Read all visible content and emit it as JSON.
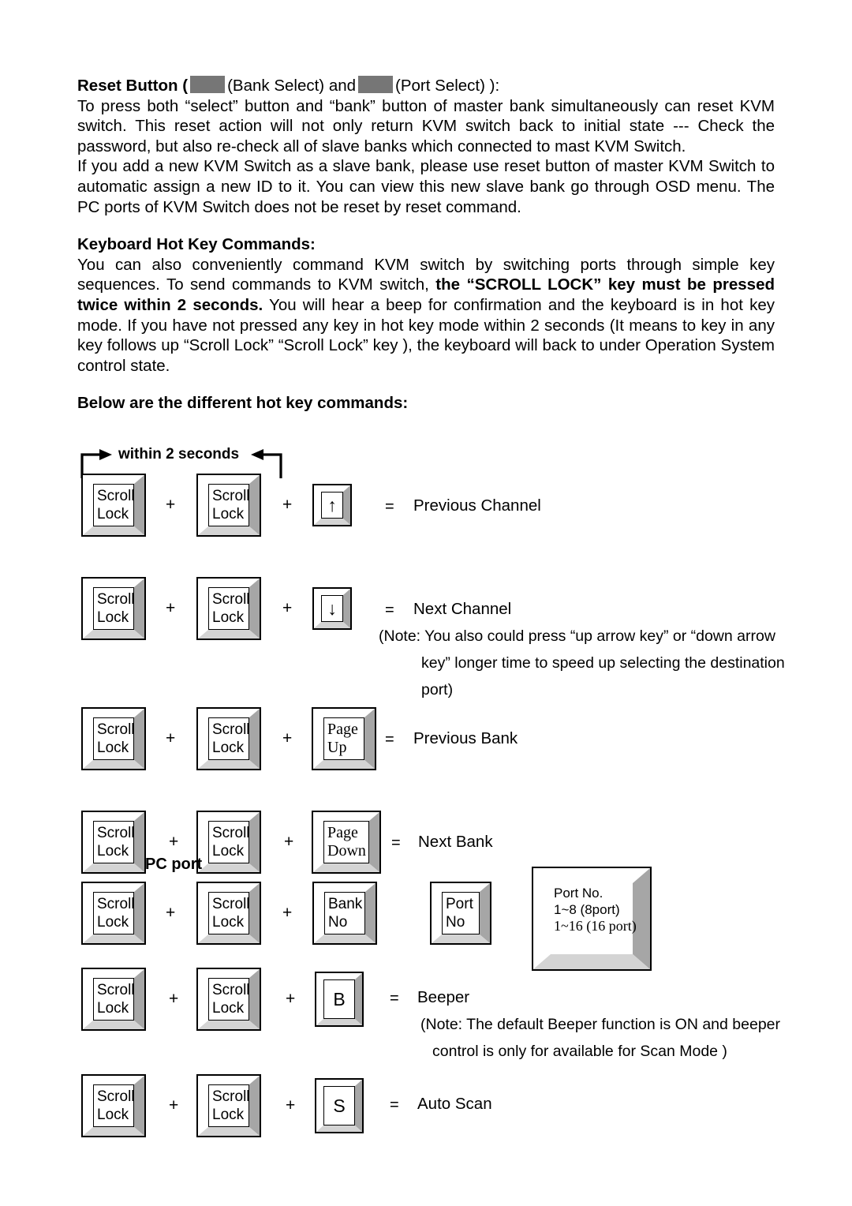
{
  "document": {
    "reset_section": {
      "heading_prefix": "Reset Button (",
      "bank_select_label": "(Bank Select) and",
      "port_select_label": "(Port Select) ):",
      "swatch_color": "#767676",
      "body": "To press both “select” button and “bank” button of master bank simultaneously can reset KVM switch. This reset action will not only return KVM switch back to initial state --- Check the password, but also re-check all of slave banks which connected to mast KVM Switch.",
      "body2": "If you add a new KVM Switch as a slave bank, please use reset button of master KVM Switch to automatic assign a new ID to it. You can view this new slave bank go through OSD menu. The PC ports of KVM Switch does not be reset by reset command."
    },
    "hotkey_section": {
      "heading": "Keyboard Hot Key Commands:",
      "body_a": "You can also conveniently command KVM switch by switching ports through simple key sequences. To send commands to KVM switch, ",
      "body_bold1": "the “SCROLL LOCK” key must be pressed twice within 2 seconds.",
      "body_b": " You will hear a beep for confirmation and the keyboard is in hot key mode. If you have not pressed any key in hot key mode within 2 seconds (It means to key in any key follows up “Scroll Lock” “Scroll Lock” key ), the keyboard will back to under Operation System control state.",
      "subheading": "Below are the different hot key commands:"
    }
  },
  "diagram": {
    "within_label": "within 2 seconds",
    "plus": "+",
    "equals": "=",
    "pc_port_label": "PC port",
    "keys": {
      "scroll": "Scroll",
      "lock": "Lock",
      "page": "Page",
      "up": "Up",
      "down": "Down",
      "bank": "Bank",
      "no": "No",
      "port": "Port",
      "arrow_up": "↑",
      "arrow_down": "↓",
      "b": "B",
      "s": "S"
    },
    "rows": [
      {
        "third_key": "arrow-up",
        "result": "Previous Channel"
      },
      {
        "third_key": "arrow-down",
        "result": "Next Channel"
      },
      {
        "third_key": "page-up",
        "result": "Previous Bank"
      },
      {
        "third_key": "page-down",
        "result": "Next Bank"
      },
      {
        "third_key": "bank-no",
        "result": ""
      },
      {
        "third_key": "b",
        "result": "Beeper"
      },
      {
        "third_key": "s",
        "result": "Auto Scan"
      }
    ],
    "notes": {
      "channel_note_l1": "(Note: You also could press “up arrow key” or “down arrow",
      "channel_note_l2": "key” longer time to speed up selecting the destination",
      "channel_note_l3": "port)",
      "beeper_note_l1": "(Note: The default Beeper function is ON and beeper",
      "beeper_note_l2": "control is only for available for Scan Mode )"
    },
    "port_box": {
      "line1": "Port No.",
      "line2": "1~8 (8port)",
      "line3": "1~16 (16 port)"
    }
  }
}
